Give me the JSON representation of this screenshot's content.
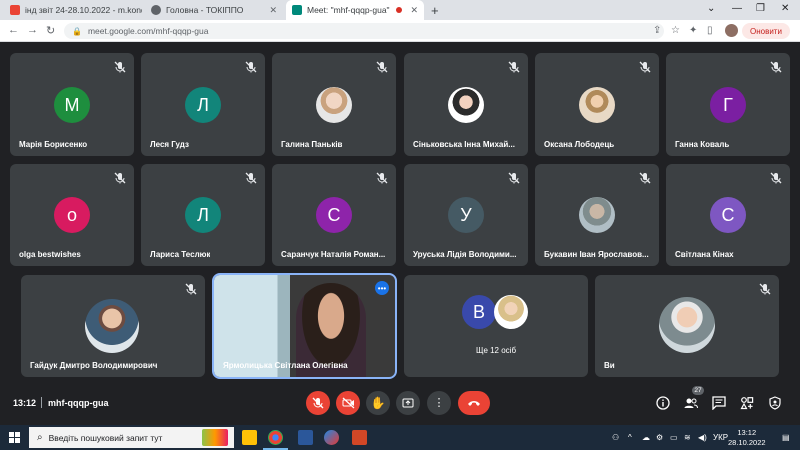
{
  "browser": {
    "tabs": [
      {
        "title": "інд звіт 24-28.10.2022 - m.kond...",
        "favicon_color": "#ea4335"
      },
      {
        "title": "Головна - ТОКІППО",
        "favicon_color": "#5f6368"
      },
      {
        "title": "Meet: \"mhf-qqqp-gua\"",
        "favicon_color": "#00897b"
      }
    ],
    "url": "meet.google.com/mhf-qqqp-gua",
    "update_label": "Оновити"
  },
  "participants": [
    {
      "name": "Марія Борисенко",
      "initial": "М",
      "color": "#1e8e3e"
    },
    {
      "name": "Леся Гудз",
      "initial": "Л",
      "color": "#12857a"
    },
    {
      "name": "Галина Паньків",
      "initial": "",
      "color": "#b0bec5"
    },
    {
      "name": "Сіньковська Інна Михай...",
      "initial": "",
      "color": "#263238"
    },
    {
      "name": "Оксана Лободець",
      "initial": "",
      "color": "#d7ccc8"
    },
    {
      "name": "Ганна Коваль",
      "initial": "Г",
      "color": "#7b1fa2"
    },
    {
      "name": "olga bestwishes",
      "initial": "o",
      "color": "#d81b60"
    },
    {
      "name": "Лариса Теслюк",
      "initial": "Л",
      "color": "#12857a"
    },
    {
      "name": "Саранчук Наталія Роман...",
      "initial": "С",
      "color": "#8e24aa"
    },
    {
      "name": "Уруська Лідія Володими...",
      "initial": "У",
      "color": "#455a64"
    },
    {
      "name": "Букавин Іван Ярославов...",
      "initial": "",
      "color": "#90a4ae"
    },
    {
      "name": "Світлана Кінах",
      "initial": "С",
      "color": "#7e57c2"
    },
    {
      "name": "Гайдук Дмитро Володимирович",
      "initial": "",
      "color": "#a1887f"
    },
    {
      "name": "Ярмолицька Світлана Олегівна",
      "initial": "",
      "color": "#5d4037"
    },
    {
      "name": "Ще 12 осіб",
      "initial": "В",
      "color": "#3949ab"
    },
    {
      "name": "Ви",
      "initial": "",
      "color": "#e0e0e0"
    }
  ],
  "meeting": {
    "time": "13:12",
    "code": "mhf-qqqp-gua",
    "participants_count": "27"
  },
  "taskbar": {
    "search_placeholder": "Введіть пошуковий запит тут",
    "language": "УКР",
    "time": "13:12",
    "date": "28.10.2022"
  }
}
